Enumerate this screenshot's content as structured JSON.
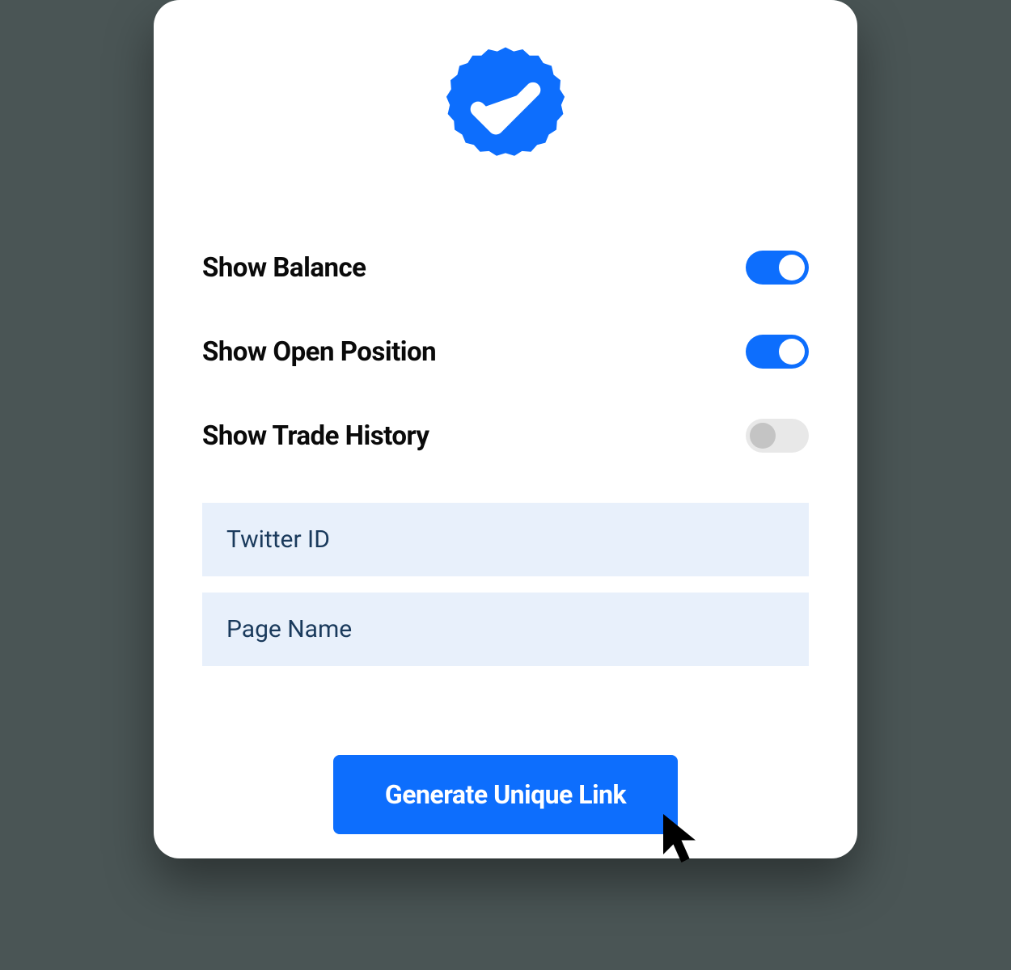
{
  "toggles": [
    {
      "label": "Show Balance",
      "on": true
    },
    {
      "label": "Show Open Position",
      "on": true
    },
    {
      "label": "Show Trade History",
      "on": false
    }
  ],
  "inputs": {
    "twitter_placeholder": "Twitter ID",
    "pagename_placeholder": "Page Name"
  },
  "button": {
    "generate_label": "Generate Unique Link"
  },
  "colors": {
    "accent": "#0d6efd",
    "input_bg": "#e8f0fb"
  }
}
